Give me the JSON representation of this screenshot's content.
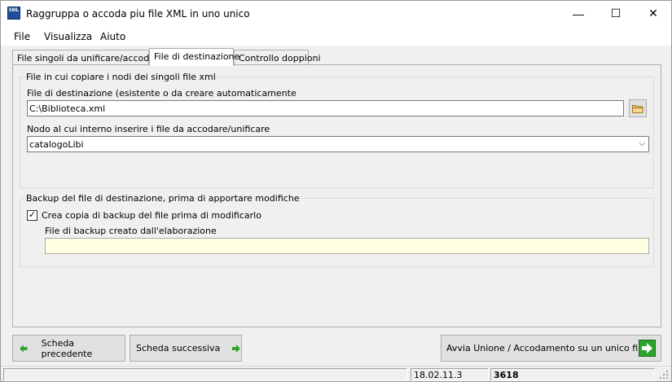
{
  "window": {
    "title": "Raggruppa o accoda piu file XML in uno unico",
    "icon_text": "XML",
    "minimize": "—",
    "maximize": "☐",
    "close": "✕"
  },
  "menu": [
    "File",
    "Visualizza",
    "Aiuto"
  ],
  "tabs": [
    {
      "label": "File singoli da unificare/accodare",
      "active": false
    },
    {
      "label": "File di destinazione",
      "active": true
    },
    {
      "label": "Controllo doppioni",
      "active": false
    }
  ],
  "group1": {
    "title": "File in cui copiare i nodi dei singoli file xml",
    "dest_label": "File di destinazione (esistente o da creare automaticamente",
    "dest_value": "C:\\Biblioteca.xml",
    "node_label": "Nodo al cui interno inserire i file da accodare/unificare",
    "node_value": "catalogoLibi"
  },
  "group2": {
    "title": "Backup del file di destinazione, prima di apportare modifiche",
    "checkbox_label": "Crea copia di backup del file prima di modificarlo",
    "checkbox_checked": true,
    "checkbox_mark": "✓",
    "backup_label": "File di backup creato dall'elaborazione",
    "backup_value": ""
  },
  "buttons": {
    "prev": "Scheda precedente",
    "next": "Scheda successiva",
    "run": "Avvia Unione / Accodamento su un unico file"
  },
  "status": {
    "left": "",
    "version": "18.02.11.3",
    "count": "3618"
  },
  "colors": {
    "arrow_green": "#2ea32e",
    "readonly_bg": "#ffffe1"
  }
}
